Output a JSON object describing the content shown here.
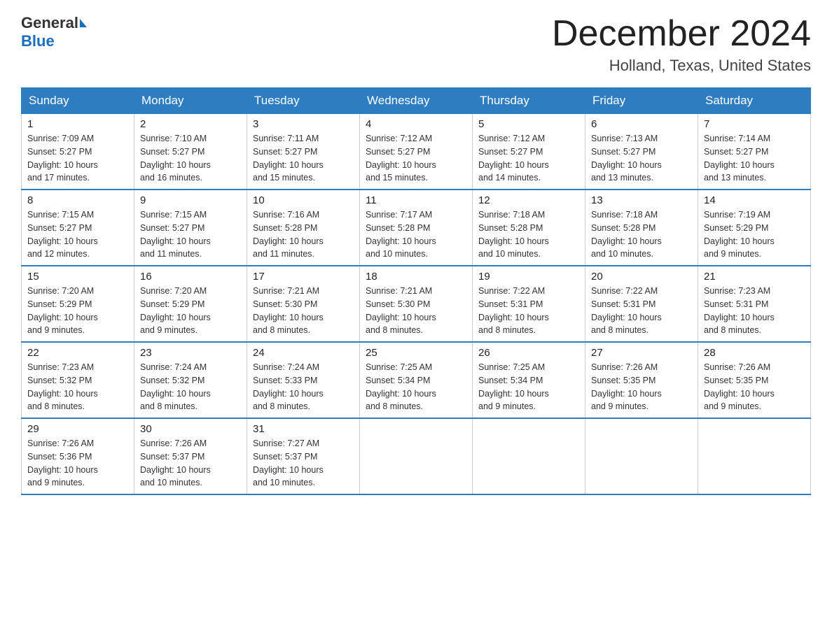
{
  "logo": {
    "general": "General",
    "blue": "Blue"
  },
  "title": "December 2024",
  "subtitle": "Holland, Texas, United States",
  "days_header": [
    "Sunday",
    "Monday",
    "Tuesday",
    "Wednesday",
    "Thursday",
    "Friday",
    "Saturday"
  ],
  "weeks": [
    [
      {
        "num": "1",
        "info": "Sunrise: 7:09 AM\nSunset: 5:27 PM\nDaylight: 10 hours\nand 17 minutes."
      },
      {
        "num": "2",
        "info": "Sunrise: 7:10 AM\nSunset: 5:27 PM\nDaylight: 10 hours\nand 16 minutes."
      },
      {
        "num": "3",
        "info": "Sunrise: 7:11 AM\nSunset: 5:27 PM\nDaylight: 10 hours\nand 15 minutes."
      },
      {
        "num": "4",
        "info": "Sunrise: 7:12 AM\nSunset: 5:27 PM\nDaylight: 10 hours\nand 15 minutes."
      },
      {
        "num": "5",
        "info": "Sunrise: 7:12 AM\nSunset: 5:27 PM\nDaylight: 10 hours\nand 14 minutes."
      },
      {
        "num": "6",
        "info": "Sunrise: 7:13 AM\nSunset: 5:27 PM\nDaylight: 10 hours\nand 13 minutes."
      },
      {
        "num": "7",
        "info": "Sunrise: 7:14 AM\nSunset: 5:27 PM\nDaylight: 10 hours\nand 13 minutes."
      }
    ],
    [
      {
        "num": "8",
        "info": "Sunrise: 7:15 AM\nSunset: 5:27 PM\nDaylight: 10 hours\nand 12 minutes."
      },
      {
        "num": "9",
        "info": "Sunrise: 7:15 AM\nSunset: 5:27 PM\nDaylight: 10 hours\nand 11 minutes."
      },
      {
        "num": "10",
        "info": "Sunrise: 7:16 AM\nSunset: 5:28 PM\nDaylight: 10 hours\nand 11 minutes."
      },
      {
        "num": "11",
        "info": "Sunrise: 7:17 AM\nSunset: 5:28 PM\nDaylight: 10 hours\nand 10 minutes."
      },
      {
        "num": "12",
        "info": "Sunrise: 7:18 AM\nSunset: 5:28 PM\nDaylight: 10 hours\nand 10 minutes."
      },
      {
        "num": "13",
        "info": "Sunrise: 7:18 AM\nSunset: 5:28 PM\nDaylight: 10 hours\nand 10 minutes."
      },
      {
        "num": "14",
        "info": "Sunrise: 7:19 AM\nSunset: 5:29 PM\nDaylight: 10 hours\nand 9 minutes."
      }
    ],
    [
      {
        "num": "15",
        "info": "Sunrise: 7:20 AM\nSunset: 5:29 PM\nDaylight: 10 hours\nand 9 minutes."
      },
      {
        "num": "16",
        "info": "Sunrise: 7:20 AM\nSunset: 5:29 PM\nDaylight: 10 hours\nand 9 minutes."
      },
      {
        "num": "17",
        "info": "Sunrise: 7:21 AM\nSunset: 5:30 PM\nDaylight: 10 hours\nand 8 minutes."
      },
      {
        "num": "18",
        "info": "Sunrise: 7:21 AM\nSunset: 5:30 PM\nDaylight: 10 hours\nand 8 minutes."
      },
      {
        "num": "19",
        "info": "Sunrise: 7:22 AM\nSunset: 5:31 PM\nDaylight: 10 hours\nand 8 minutes."
      },
      {
        "num": "20",
        "info": "Sunrise: 7:22 AM\nSunset: 5:31 PM\nDaylight: 10 hours\nand 8 minutes."
      },
      {
        "num": "21",
        "info": "Sunrise: 7:23 AM\nSunset: 5:31 PM\nDaylight: 10 hours\nand 8 minutes."
      }
    ],
    [
      {
        "num": "22",
        "info": "Sunrise: 7:23 AM\nSunset: 5:32 PM\nDaylight: 10 hours\nand 8 minutes."
      },
      {
        "num": "23",
        "info": "Sunrise: 7:24 AM\nSunset: 5:32 PM\nDaylight: 10 hours\nand 8 minutes."
      },
      {
        "num": "24",
        "info": "Sunrise: 7:24 AM\nSunset: 5:33 PM\nDaylight: 10 hours\nand 8 minutes."
      },
      {
        "num": "25",
        "info": "Sunrise: 7:25 AM\nSunset: 5:34 PM\nDaylight: 10 hours\nand 8 minutes."
      },
      {
        "num": "26",
        "info": "Sunrise: 7:25 AM\nSunset: 5:34 PM\nDaylight: 10 hours\nand 9 minutes."
      },
      {
        "num": "27",
        "info": "Sunrise: 7:26 AM\nSunset: 5:35 PM\nDaylight: 10 hours\nand 9 minutes."
      },
      {
        "num": "28",
        "info": "Sunrise: 7:26 AM\nSunset: 5:35 PM\nDaylight: 10 hours\nand 9 minutes."
      }
    ],
    [
      {
        "num": "29",
        "info": "Sunrise: 7:26 AM\nSunset: 5:36 PM\nDaylight: 10 hours\nand 9 minutes."
      },
      {
        "num": "30",
        "info": "Sunrise: 7:26 AM\nSunset: 5:37 PM\nDaylight: 10 hours\nand 10 minutes."
      },
      {
        "num": "31",
        "info": "Sunrise: 7:27 AM\nSunset: 5:37 PM\nDaylight: 10 hours\nand 10 minutes."
      },
      {
        "num": "",
        "info": ""
      },
      {
        "num": "",
        "info": ""
      },
      {
        "num": "",
        "info": ""
      },
      {
        "num": "",
        "info": ""
      }
    ]
  ]
}
